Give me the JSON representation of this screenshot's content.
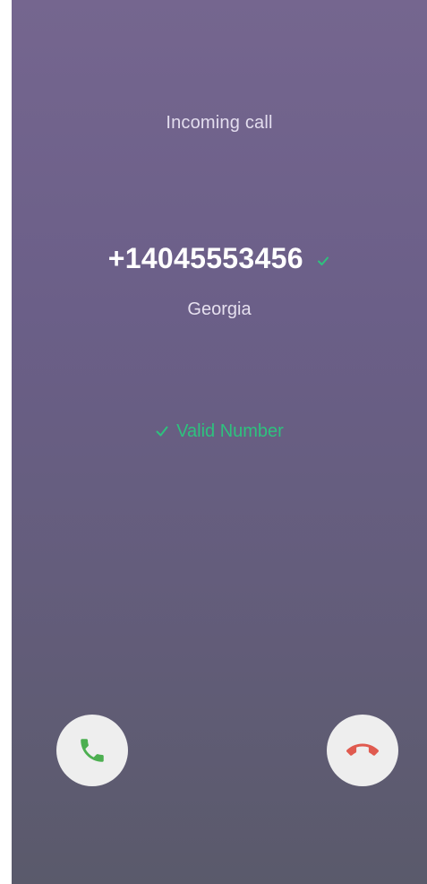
{
  "call": {
    "status_label": "Incoming call",
    "caller_number": "+14045553456",
    "caller_location": "Georgia",
    "validation_text": "Valid Number"
  },
  "icons": {
    "verified": "check-icon",
    "validation": "check-icon",
    "answer": "phone-icon",
    "decline": "phone-hangup-icon"
  },
  "colors": {
    "background_top": "#75668f",
    "background_bottom": "#5a5a6b",
    "accent_green": "#2ec27e",
    "answer_green": "#4caf50",
    "decline_red": "#e05a4f",
    "button_bg": "#eeeeee"
  }
}
